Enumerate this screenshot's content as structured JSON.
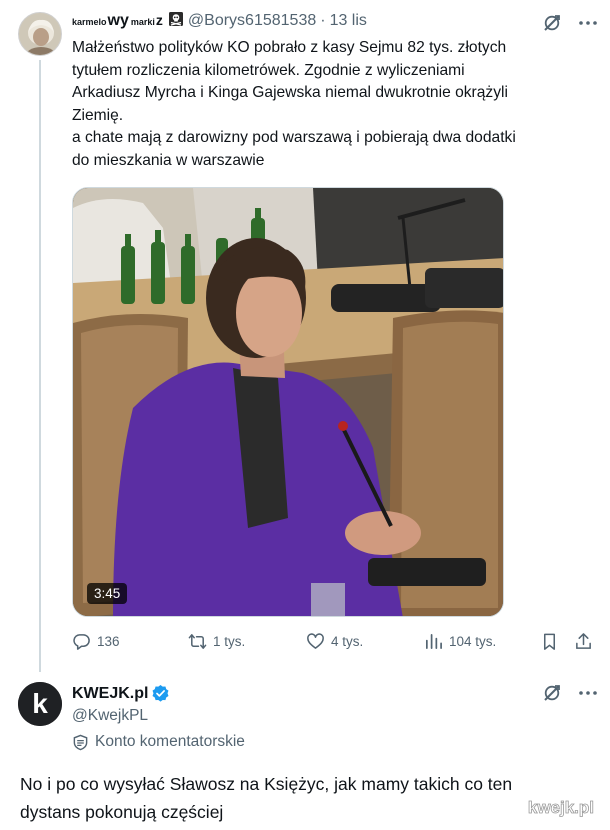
{
  "tweet": {
    "author": {
      "display_name_parts": [
        "karmelo",
        "wy",
        "marki",
        "z"
      ],
      "handle": "@Borys61581538",
      "timestamp": "13 lis"
    },
    "text_lines": [
      "Małżeństwo polityków KO pobrało z kasy Sejmu 82 tys. złotych",
      "tytułem rozliczenia kilometrówek. Zgodnie z wyliczeniami",
      "Arkadiusz Myrcha i Kinga Gajewska niemal dwukrotnie okrążyli",
      "Ziemię.",
      "a chate mają z darowizny pod warszawą i pobierają dwa dodatki",
      "do mieszkania w warszawie"
    ],
    "media": {
      "duration": "3:45"
    },
    "stats": {
      "replies": "136",
      "reposts": "1 tys.",
      "likes": "4 tys.",
      "views": "104 tys."
    }
  },
  "reply": {
    "author": {
      "display_name": "KWEJK.pl",
      "handle": "@KwejkPL",
      "label": "Konto komentatorskie",
      "avatar_letter": "k"
    },
    "text_lines": [
      "No i po co wysyłać Sławosz na Księżyc, jak mamy takich co ten",
      "dystans pokonują częściej"
    ]
  },
  "watermark": {
    "text": "kwejk.pl"
  },
  "colors": {
    "text": "#0f1419",
    "muted": "#536471",
    "verified": "#1d9bf0",
    "thread_line": "#cfd9de"
  }
}
